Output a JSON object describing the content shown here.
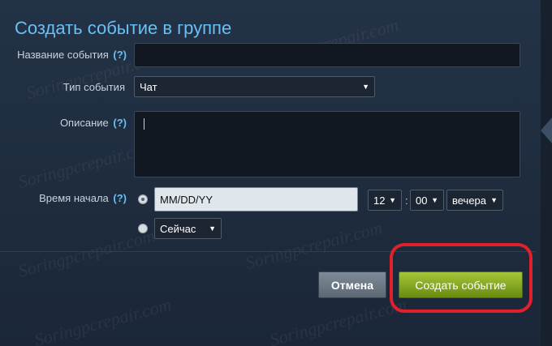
{
  "form": {
    "title": "Создать событие в группе",
    "name_label": "Название события",
    "type_label": "Тип события",
    "description_label": "Описание",
    "start_label": "Время начала",
    "help": "(?)",
    "type_value": "Чат",
    "date_placeholder": "MM/DD/YY",
    "hour_value": "12",
    "minute_value": "00",
    "ampm_value": "вечера",
    "now_value": "Сейчас",
    "colon": ":"
  },
  "buttons": {
    "cancel": "Отмена",
    "create": "Создать событие"
  },
  "watermark": "Soringpcrepair.com",
  "colors": {
    "accent_blue": "#67c1f5",
    "create_green": "#a4c639",
    "highlight_red": "#e0202a"
  }
}
